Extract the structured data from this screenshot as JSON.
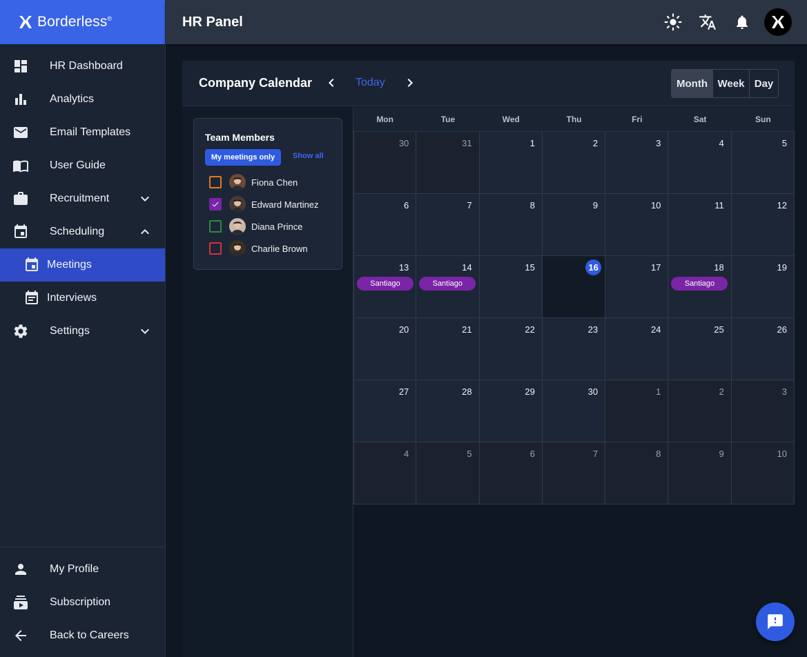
{
  "brand": {
    "name": "Borderless",
    "mark": "®"
  },
  "topbar": {
    "title": "HR Panel"
  },
  "sidebar": {
    "items": [
      {
        "label": "HR Dashboard"
      },
      {
        "label": "Analytics"
      },
      {
        "label": "Email Templates"
      },
      {
        "label": "User Guide"
      },
      {
        "label": "Recruitment"
      },
      {
        "label": "Scheduling"
      },
      {
        "label": "Meetings"
      },
      {
        "label": "Interviews"
      },
      {
        "label": "Settings"
      }
    ],
    "bottom": [
      {
        "label": "My Profile"
      },
      {
        "label": "Subscription"
      },
      {
        "label": "Back to Careers"
      }
    ]
  },
  "calendar": {
    "title": "Company Calendar",
    "today_label": "Today",
    "views": [
      "Month",
      "Week",
      "Day"
    ],
    "active_view": "Month",
    "weekdays": [
      "Mon",
      "Tue",
      "Wed",
      "Thu",
      "Fri",
      "Sat",
      "Sun"
    ],
    "weeks": [
      [
        {
          "d": "30",
          "other": true
        },
        {
          "d": "31",
          "other": true
        },
        {
          "d": "1"
        },
        {
          "d": "2"
        },
        {
          "d": "3"
        },
        {
          "d": "4"
        },
        {
          "d": "5"
        }
      ],
      [
        {
          "d": "6"
        },
        {
          "d": "7"
        },
        {
          "d": "8"
        },
        {
          "d": "9"
        },
        {
          "d": "10"
        },
        {
          "d": "11"
        },
        {
          "d": "12"
        }
      ],
      [
        {
          "d": "13",
          "event": "Santiago"
        },
        {
          "d": "14",
          "event": "Santiago"
        },
        {
          "d": "15"
        },
        {
          "d": "16",
          "today": true
        },
        {
          "d": "17"
        },
        {
          "d": "18",
          "event": "Santiago"
        },
        {
          "d": "19"
        }
      ],
      [
        {
          "d": "20"
        },
        {
          "d": "21"
        },
        {
          "d": "22"
        },
        {
          "d": "23"
        },
        {
          "d": "24"
        },
        {
          "d": "25"
        },
        {
          "d": "26"
        }
      ],
      [
        {
          "d": "27"
        },
        {
          "d": "28"
        },
        {
          "d": "29"
        },
        {
          "d": "30"
        },
        {
          "d": "1",
          "other": true
        },
        {
          "d": "2",
          "other": true
        },
        {
          "d": "3",
          "other": true
        }
      ],
      [
        {
          "d": "4",
          "other": true
        },
        {
          "d": "5",
          "other": true
        },
        {
          "d": "6",
          "other": true
        },
        {
          "d": "7",
          "other": true
        },
        {
          "d": "8",
          "other": true
        },
        {
          "d": "9",
          "other": true
        },
        {
          "d": "10",
          "other": true
        }
      ]
    ]
  },
  "team": {
    "title": "Team Members",
    "my_meetings_label": "My meetings only",
    "show_all_label": "Show all",
    "members": [
      {
        "name": "Fiona Chen",
        "color": "#e07a1f",
        "checked": false
      },
      {
        "name": "Edward Martinez",
        "color": "#7a24a6",
        "checked": true
      },
      {
        "name": "Diana Prince",
        "color": "#2e8b3a",
        "checked": false
      },
      {
        "name": "Charlie Brown",
        "color": "#d6323a",
        "checked": false
      }
    ]
  },
  "colors": {
    "accent": "#2f5be0",
    "brand": "#3a64e6",
    "event": "#7a24a6"
  }
}
